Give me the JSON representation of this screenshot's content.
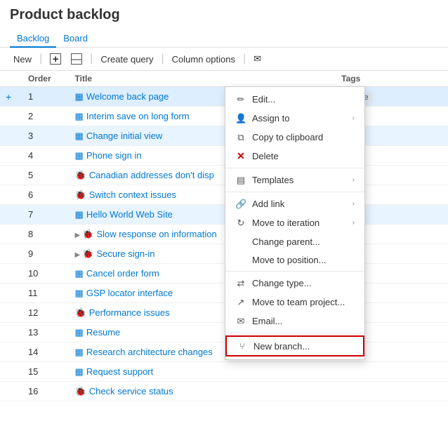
{
  "header": {
    "title": "Product backlog"
  },
  "tabs": [
    {
      "label": "Backlog",
      "active": true
    },
    {
      "label": "Board",
      "active": false
    }
  ],
  "toolbar": {
    "new_label": "New",
    "create_query_label": "Create query",
    "column_options_label": "Column options"
  },
  "columns": {
    "add": "",
    "order": "Order",
    "title": "Title",
    "ellipsis": "",
    "tags": "Tags"
  },
  "rows": [
    {
      "order": "1",
      "type": "blue",
      "title": "Welcome back page",
      "tags": "Mobile",
      "expanded": false,
      "selected": true
    },
    {
      "order": "2",
      "type": "blue",
      "title": "Interim save on long form",
      "tags": "",
      "expanded": false
    },
    {
      "order": "3",
      "type": "blue",
      "title": "Change initial view",
      "tags": "",
      "expanded": false,
      "highlighted": true
    },
    {
      "order": "4",
      "type": "blue",
      "title": "Phone sign in",
      "tags": "",
      "expanded": false
    },
    {
      "order": "5",
      "type": "red",
      "title": "Canadian addresses don't disp",
      "tags": "",
      "expanded": false
    },
    {
      "order": "6",
      "type": "red",
      "title": "Switch context issues",
      "tags": "",
      "expanded": false
    },
    {
      "order": "7",
      "type": "blue",
      "title": "Hello World Web Site",
      "tags": "",
      "expanded": false,
      "highlighted": true
    },
    {
      "order": "8",
      "type": "red",
      "title": "Slow response on information",
      "tags": "",
      "expanded": true
    },
    {
      "order": "9",
      "type": "red",
      "title": "Secure sign-in",
      "tags": "",
      "expanded": true
    },
    {
      "order": "10",
      "type": "blue",
      "title": "Cancel order form",
      "tags": "",
      "expanded": false
    },
    {
      "order": "11",
      "type": "blue",
      "title": "GSP locator interface",
      "tags": "",
      "expanded": false
    },
    {
      "order": "12",
      "type": "red",
      "title": "Performance issues",
      "tags": "",
      "expanded": false
    },
    {
      "order": "13",
      "type": "blue",
      "title": "Resume",
      "tags": "",
      "expanded": false
    },
    {
      "order": "14",
      "type": "blue",
      "title": "Research architecture changes",
      "tags": "",
      "expanded": false
    },
    {
      "order": "15",
      "type": "blue",
      "title": "Request support",
      "tags": "",
      "expanded": false
    },
    {
      "order": "16",
      "type": "red",
      "title": "Check service status",
      "tags": "",
      "expanded": false
    }
  ],
  "context_menu": {
    "items": [
      {
        "label": "Edit...",
        "icon": "✏️",
        "has_sub": false,
        "type": "normal"
      },
      {
        "label": "Assign to",
        "icon": "👤",
        "has_sub": true,
        "type": "normal"
      },
      {
        "label": "Copy to clipboard",
        "icon": "📋",
        "has_sub": false,
        "type": "normal"
      },
      {
        "label": "Delete",
        "icon": "✗",
        "has_sub": false,
        "type": "delete"
      },
      {
        "label": "Templates",
        "icon": "▤",
        "has_sub": true,
        "type": "normal"
      },
      {
        "label": "Add link",
        "icon": "🔗",
        "has_sub": true,
        "type": "normal"
      },
      {
        "label": "Move to iteration",
        "icon": "↻",
        "has_sub": true,
        "type": "normal"
      },
      {
        "label": "Change parent...",
        "icon": "",
        "has_sub": false,
        "type": "normal"
      },
      {
        "label": "Move to position...",
        "icon": "",
        "has_sub": false,
        "type": "normal"
      },
      {
        "label": "Change type...",
        "icon": "⇄",
        "has_sub": false,
        "type": "normal"
      },
      {
        "label": "Move to team project...",
        "icon": "↗",
        "has_sub": false,
        "type": "normal"
      },
      {
        "label": "Email...",
        "icon": "✉",
        "has_sub": false,
        "type": "normal"
      },
      {
        "label": "New branch...",
        "icon": "⑂",
        "has_sub": false,
        "type": "highlighted"
      }
    ]
  }
}
